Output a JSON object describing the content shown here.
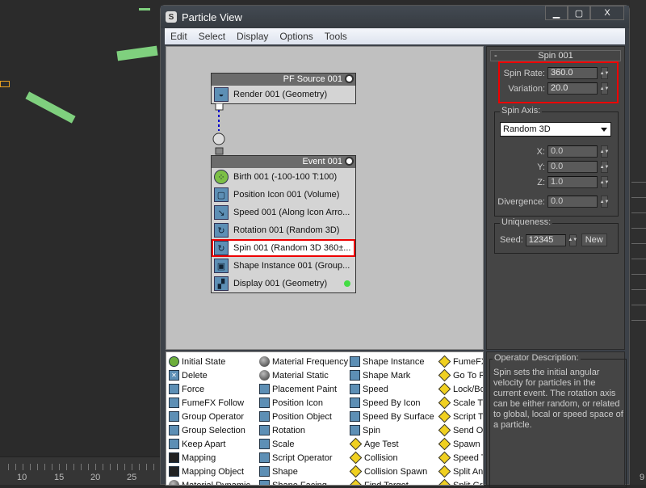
{
  "window": {
    "title": "Particle View",
    "app_icon": "3dsmax-icon",
    "controls": {
      "minimize": "▁",
      "maximize": "▢",
      "close": "X"
    }
  },
  "menu": [
    "Edit",
    "Select",
    "Display",
    "Options",
    "Tools"
  ],
  "graph": {
    "source_node": {
      "title": "PF Source 001",
      "operators": [
        {
          "label": "Render 001 (Geometry)",
          "icon": "teapot-icon"
        }
      ]
    },
    "event_node": {
      "title": "Event 001",
      "operators": [
        {
          "label": "Birth 001 (-100-100 T:100)",
          "icon": "birth-icon"
        },
        {
          "label": "Position Icon 001 (Volume)",
          "icon": "position-icon"
        },
        {
          "label": "Speed 001 (Along Icon Arro...",
          "icon": "speed-icon"
        },
        {
          "label": "Rotation 001 (Random 3D)",
          "icon": "rotation-icon"
        },
        {
          "label": "Spin 001 (Random 3D 360±...",
          "icon": "spin-icon",
          "selected": true
        },
        {
          "label": "Shape Instance 001 (Group...",
          "icon": "shape-instance-icon"
        },
        {
          "label": "Display 001 (Geometry)",
          "icon": "display-icon"
        }
      ]
    }
  },
  "depot": {
    "columns": [
      [
        {
          "label": "Initial State",
          "icon": "green"
        },
        {
          "label": "Delete",
          "icon": "x"
        },
        {
          "label": "Force",
          "icon": "op"
        },
        {
          "label": "FumeFX Follow",
          "icon": "op"
        },
        {
          "label": "Group Operator",
          "icon": "op"
        },
        {
          "label": "Group Selection",
          "icon": "op"
        },
        {
          "label": "Keep Apart",
          "icon": "op"
        },
        {
          "label": "Mapping",
          "icon": "dark"
        },
        {
          "label": "Mapping Object",
          "icon": "dark"
        },
        {
          "label": "Material Dynamic",
          "icon": "sphere"
        }
      ],
      [
        {
          "label": "Material Frequency",
          "icon": "sphere"
        },
        {
          "label": "Material Static",
          "icon": "sphere"
        },
        {
          "label": "Placement Paint",
          "icon": "op"
        },
        {
          "label": "Position Icon",
          "icon": "op"
        },
        {
          "label": "Position Object",
          "icon": "op"
        },
        {
          "label": "Rotation",
          "icon": "op"
        },
        {
          "label": "Scale",
          "icon": "op"
        },
        {
          "label": "Script Operator",
          "icon": "op"
        },
        {
          "label": "Shape",
          "icon": "op"
        },
        {
          "label": "Shape Facing",
          "icon": "op"
        }
      ],
      [
        {
          "label": "Shape Instance",
          "icon": "op"
        },
        {
          "label": "Shape Mark",
          "icon": "op"
        },
        {
          "label": "Speed",
          "icon": "op"
        },
        {
          "label": "Speed By Icon",
          "icon": "op"
        },
        {
          "label": "Speed By Surface",
          "icon": "op"
        },
        {
          "label": "Spin",
          "icon": "op"
        },
        {
          "label": "Age Test",
          "icon": "test"
        },
        {
          "label": "Collision",
          "icon": "test"
        },
        {
          "label": "Collision Spawn",
          "icon": "test"
        },
        {
          "label": "Find Target",
          "icon": "test"
        }
      ],
      [
        {
          "label": "FumeFX",
          "icon": "test"
        },
        {
          "label": "Go To R",
          "icon": "test"
        },
        {
          "label": "Lock/Bo",
          "icon": "test"
        },
        {
          "label": "Scale T",
          "icon": "test"
        },
        {
          "label": "Script T",
          "icon": "test"
        },
        {
          "label": "Send O",
          "icon": "test"
        },
        {
          "label": "Spawn",
          "icon": "test"
        },
        {
          "label": "Speed T",
          "icon": "test"
        },
        {
          "label": "Split An",
          "icon": "test"
        },
        {
          "label": "Split Gr",
          "icon": "test"
        }
      ]
    ]
  },
  "params": {
    "rollout_title": "Spin 001",
    "collapse": "-",
    "spin_rate": {
      "label": "Spin Rate:",
      "value": "360.0"
    },
    "variation": {
      "label": "Variation:",
      "value": "20.0"
    },
    "spin_axis": {
      "label": "Spin Axis:",
      "selected": "Random 3D",
      "x": {
        "label": "X:",
        "value": "0.0"
      },
      "y": {
        "label": "Y:",
        "value": "0.0"
      },
      "z": {
        "label": "Z:",
        "value": "1.0"
      },
      "divergence": {
        "label": "Divergence:",
        "value": "0.0"
      }
    },
    "uniqueness": {
      "label": "Uniqueness:",
      "seed_label": "Seed:",
      "seed": "12345",
      "new_label": "New"
    }
  },
  "description": {
    "label": "Operator Description:",
    "text": "Spin sets the initial angular velocity for particles in the current event. The rotation axis can be either random, or related to global, local or speed space of a particle."
  },
  "timeline": {
    "ticks": [
      "10",
      "15",
      "20",
      "25"
    ],
    "right_tick": "9"
  },
  "colors": {
    "highlight": "#ee0000",
    "depot_test": "#f0d020",
    "active_dot": "#44dd44"
  }
}
